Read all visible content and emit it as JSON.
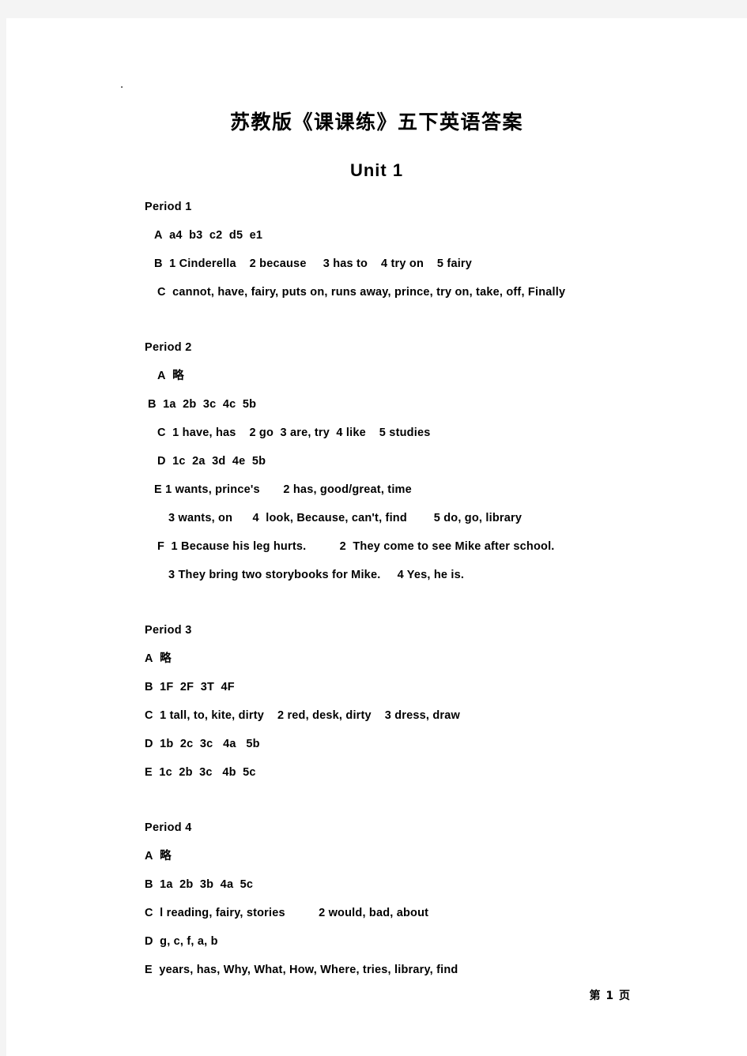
{
  "document": {
    "stray_mark": ".",
    "title": "苏教版《课课练》五下英语答案",
    "unit_heading": "Unit 1",
    "footer": "第 1 页",
    "page_background": "#ffffff",
    "canvas_background": "#f4f4f4",
    "text_color": "#000000"
  },
  "periods": [
    {
      "heading": "Period 1",
      "lines": [
        {
          "label": "A",
          "content": "a4  b3  c2  d5  e1"
        },
        {
          "label": "B",
          "content": "1 Cinderella    2 because     3 has to    4 try on    5 fairy"
        },
        {
          "label": "C",
          "content": "cannot, have, fairy, puts on, runs away, prince, try on, take, off, Finally"
        }
      ]
    },
    {
      "heading": "Period 2",
      "lines": [
        {
          "label": "A",
          "content": "略"
        },
        {
          "label": "B",
          "content": "1a  2b  3c  4c  5b"
        },
        {
          "label": "C",
          "content": "1 have, has    2 go  3 are, try  4 like    5 studies"
        },
        {
          "label": "D",
          "content": "1c  2a  3d  4e  5b"
        },
        {
          "label": "E",
          "content": "1 wants, prince's       2 has, good/great, time"
        },
        {
          "label": "",
          "content": "3 wants, on      4  look, Because, can't, find        5 do, go, library"
        },
        {
          "label": "F",
          "content": "1 Because his leg hurts.          2  They come to see Mike after school."
        },
        {
          "label": "",
          "content": "3 They bring two storybooks for Mike.     4 Yes, he is."
        }
      ]
    },
    {
      "heading": "Period 3",
      "lines": [
        {
          "label": "A",
          "content": "略"
        },
        {
          "label": "B",
          "content": "1F  2F  3T  4F"
        },
        {
          "label": "C",
          "content": "1 tall, to, kite, dirty    2 red, desk, dirty    3 dress, draw"
        },
        {
          "label": "D",
          "content": "1b  2c  3c   4a   5b"
        },
        {
          "label": "E",
          "content": "1c  2b  3c   4b  5c"
        }
      ]
    },
    {
      "heading": "Period 4",
      "lines": [
        {
          "label": "A",
          "content": "略"
        },
        {
          "label": "B",
          "content": "1a  2b  3b  4a  5c"
        },
        {
          "label": "C",
          "content": "l reading, fairy, stories          2 would, bad, about"
        },
        {
          "label": "D",
          "content": "g, c, f, a, b"
        },
        {
          "label": "E",
          "content": "years, has, Why, What, How, Where, tries, library, find"
        }
      ]
    }
  ]
}
